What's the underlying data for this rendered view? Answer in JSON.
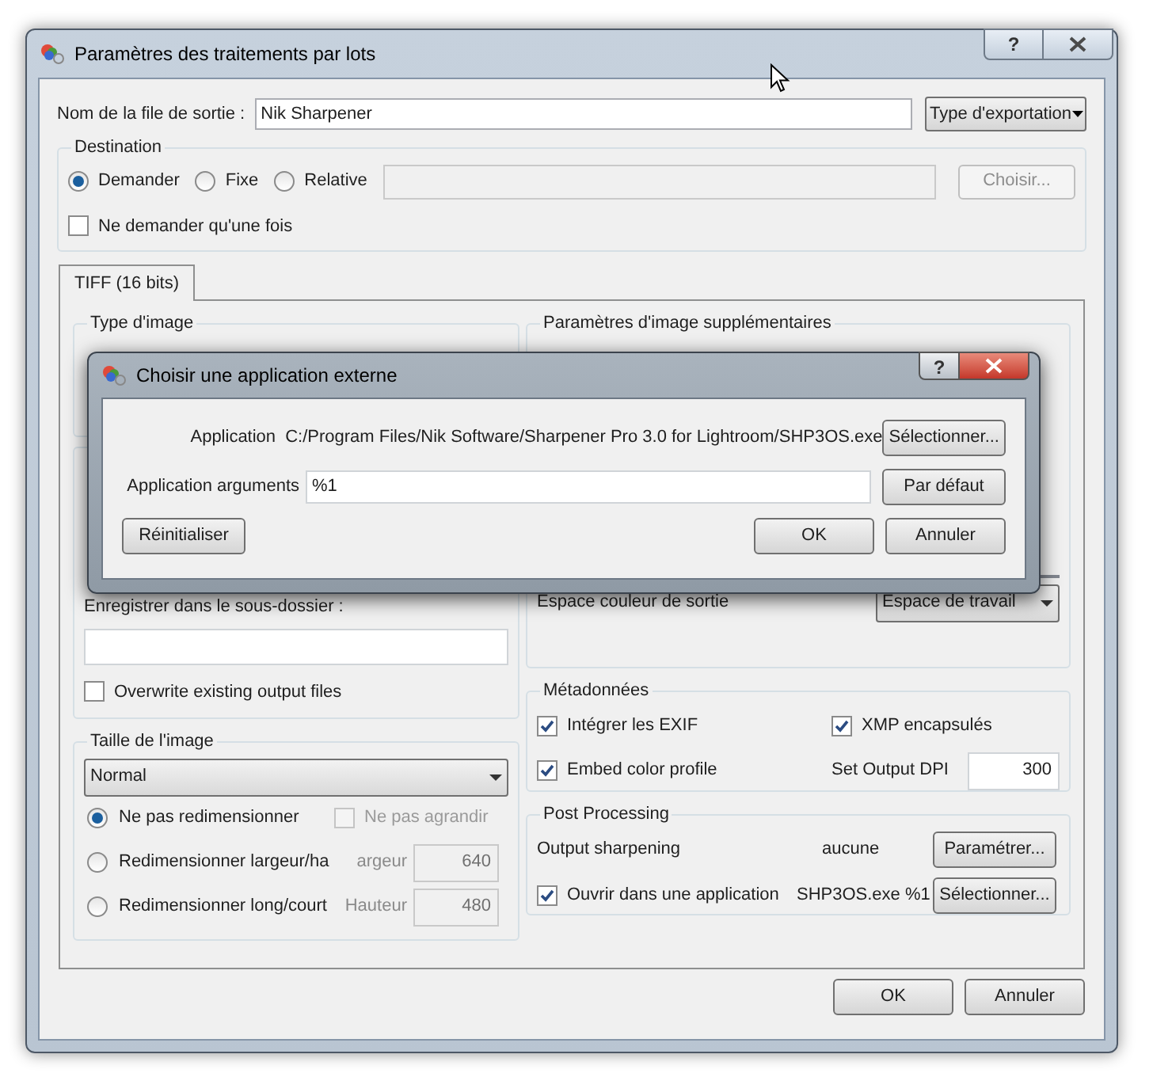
{
  "window": {
    "title": "Paramètres des traitements par lots",
    "help_button": "?"
  },
  "output_name": {
    "label": "Nom de la file de sortie :",
    "value": "Nik Sharpener",
    "export_button": "Type d'exportation"
  },
  "destination": {
    "title": "Destination",
    "options": [
      {
        "label": "Demander",
        "selected": true
      },
      {
        "label": "Fixe",
        "selected": false
      },
      {
        "label": "Relative",
        "selected": false
      }
    ],
    "path_disabled": true,
    "choose_button": {
      "label": "Choisir...",
      "disabled": true
    },
    "ask_once": {
      "label": "Ne demander qu'une fois",
      "checked": false
    }
  },
  "tabs": [
    {
      "label": "TIFF (16 bits)",
      "selected": true
    }
  ],
  "image_type": {
    "title": "Type d'image"
  },
  "subfolder": {
    "label": "Enregistrer dans le sous-dossier :",
    "overwrite": {
      "label": "Overwrite existing output files",
      "checked": false
    }
  },
  "image_size": {
    "title": "Taille de l'image",
    "mode": "Normal",
    "options": [
      {
        "label": "Ne pas redimensionner",
        "selected": true
      },
      {
        "label": "Redimensionner largeur/ha",
        "selected": false
      },
      {
        "label": "Redimensionner long/court",
        "selected": false
      }
    ],
    "no_enlarge": {
      "label": "Ne pas agrandir",
      "checked": false,
      "disabled": true
    },
    "fields": [
      {
        "label": "argeur",
        "value": "640",
        "disabled": true
      },
      {
        "label": "Hauteur",
        "value": "480",
        "disabled": true
      }
    ]
  },
  "extra_params": {
    "title": "Paramètres d'image supplémentaires",
    "color_space_label": "Espace couleur de sortie",
    "color_space": "Espace de travail"
  },
  "metadata": {
    "title": "Métadonnées",
    "checks": [
      {
        "label": "Intégrer les EXIF",
        "checked": true
      },
      {
        "label": "XMP encapsulés",
        "checked": true
      },
      {
        "label": "Embed color profile",
        "checked": true
      }
    ],
    "dpi_label": "Set Output DPI",
    "dpi": "300"
  },
  "post_processing": {
    "title": "Post Processing",
    "sharpening": {
      "label": "Output sharpening",
      "value": "aucune",
      "button": "Paramétrer..."
    },
    "open_in_app": {
      "label": "Ouvrir dans une application",
      "checked": true,
      "value": "SHP3OS.exe %1",
      "button": "Sélectionner..."
    }
  },
  "buttons": [
    "OK",
    "Annuler"
  ],
  "modal": {
    "title": "Choisir une application externe",
    "help_button": "?",
    "application_label": "Application",
    "application_path": "C:/Program Files/Nik Software/Sharpener Pro 3.0 for Lightroom/SHP3OS.exe",
    "select_button": "Sélectionner...",
    "arguments_label": "Application arguments",
    "arguments": "%1",
    "default_button": "Par défaut",
    "reset_button": "Réinitialiser",
    "buttons": [
      "OK",
      "Annuler"
    ]
  }
}
